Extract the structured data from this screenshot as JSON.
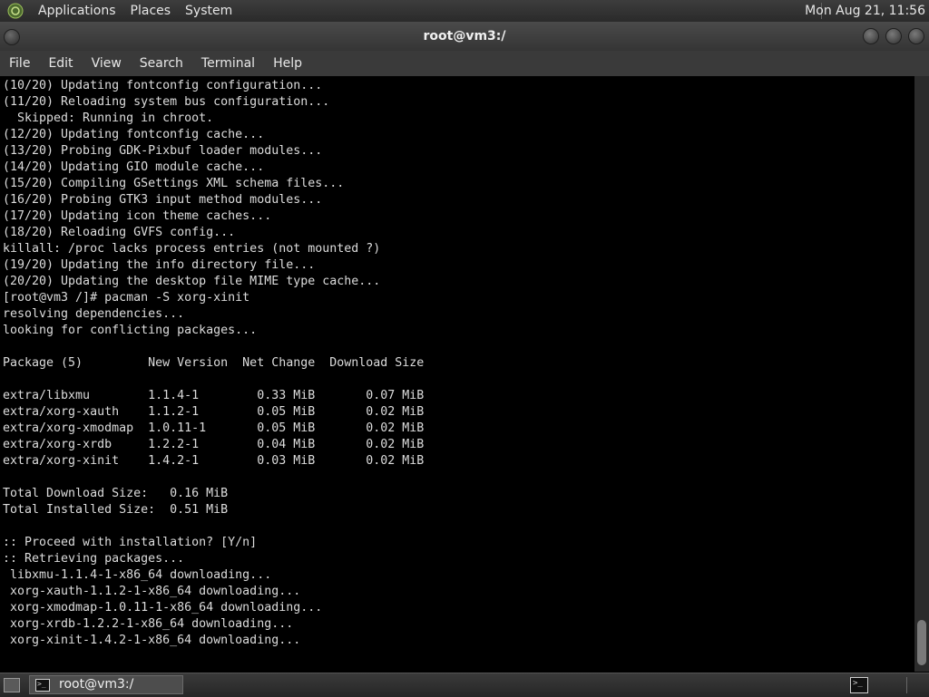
{
  "top_panel": {
    "menus": [
      "Applications",
      "Places",
      "System"
    ],
    "clock": "Mon Aug 21, 11:56"
  },
  "window": {
    "title": "root@vm3:/"
  },
  "menubar": [
    "File",
    "Edit",
    "View",
    "Search",
    "Terminal",
    "Help"
  ],
  "terminal": {
    "lines": [
      "(10/20) Updating fontconfig configuration...",
      "(11/20) Reloading system bus configuration...",
      "  Skipped: Running in chroot.",
      "(12/20) Updating fontconfig cache...",
      "(13/20) Probing GDK-Pixbuf loader modules...",
      "(14/20) Updating GIO module cache...",
      "(15/20) Compiling GSettings XML schema files...",
      "(16/20) Probing GTK3 input method modules...",
      "(17/20) Updating icon theme caches...",
      "(18/20) Reloading GVFS config...",
      "killall: /proc lacks process entries (not mounted ?)",
      "(19/20) Updating the info directory file...",
      "(20/20) Updating the desktop file MIME type cache...",
      "[root@vm3 /]# pacman -S xorg-xinit",
      "resolving dependencies...",
      "looking for conflicting packages...",
      "",
      "Package (5)         New Version  Net Change  Download Size",
      "",
      "extra/libxmu        1.1.4-1        0.33 MiB       0.07 MiB",
      "extra/xorg-xauth    1.1.2-1        0.05 MiB       0.02 MiB",
      "extra/xorg-xmodmap  1.0.11-1       0.05 MiB       0.02 MiB",
      "extra/xorg-xrdb     1.2.2-1        0.04 MiB       0.02 MiB",
      "extra/xorg-xinit    1.4.2-1        0.03 MiB       0.02 MiB",
      "",
      "Total Download Size:   0.16 MiB",
      "Total Installed Size:  0.51 MiB",
      "",
      ":: Proceed with installation? [Y/n]",
      ":: Retrieving packages...",
      " libxmu-1.1.4-1-x86_64 downloading...",
      " xorg-xauth-1.1.2-1-x86_64 downloading...",
      " xorg-xmodmap-1.0.11-1-x86_64 downloading...",
      " xorg-xrdb-1.2.2-1-x86_64 downloading...",
      " xorg-xinit-1.4.2-1-x86_64 downloading..."
    ]
  },
  "taskbar": {
    "task_label": "root@vm3:/"
  }
}
